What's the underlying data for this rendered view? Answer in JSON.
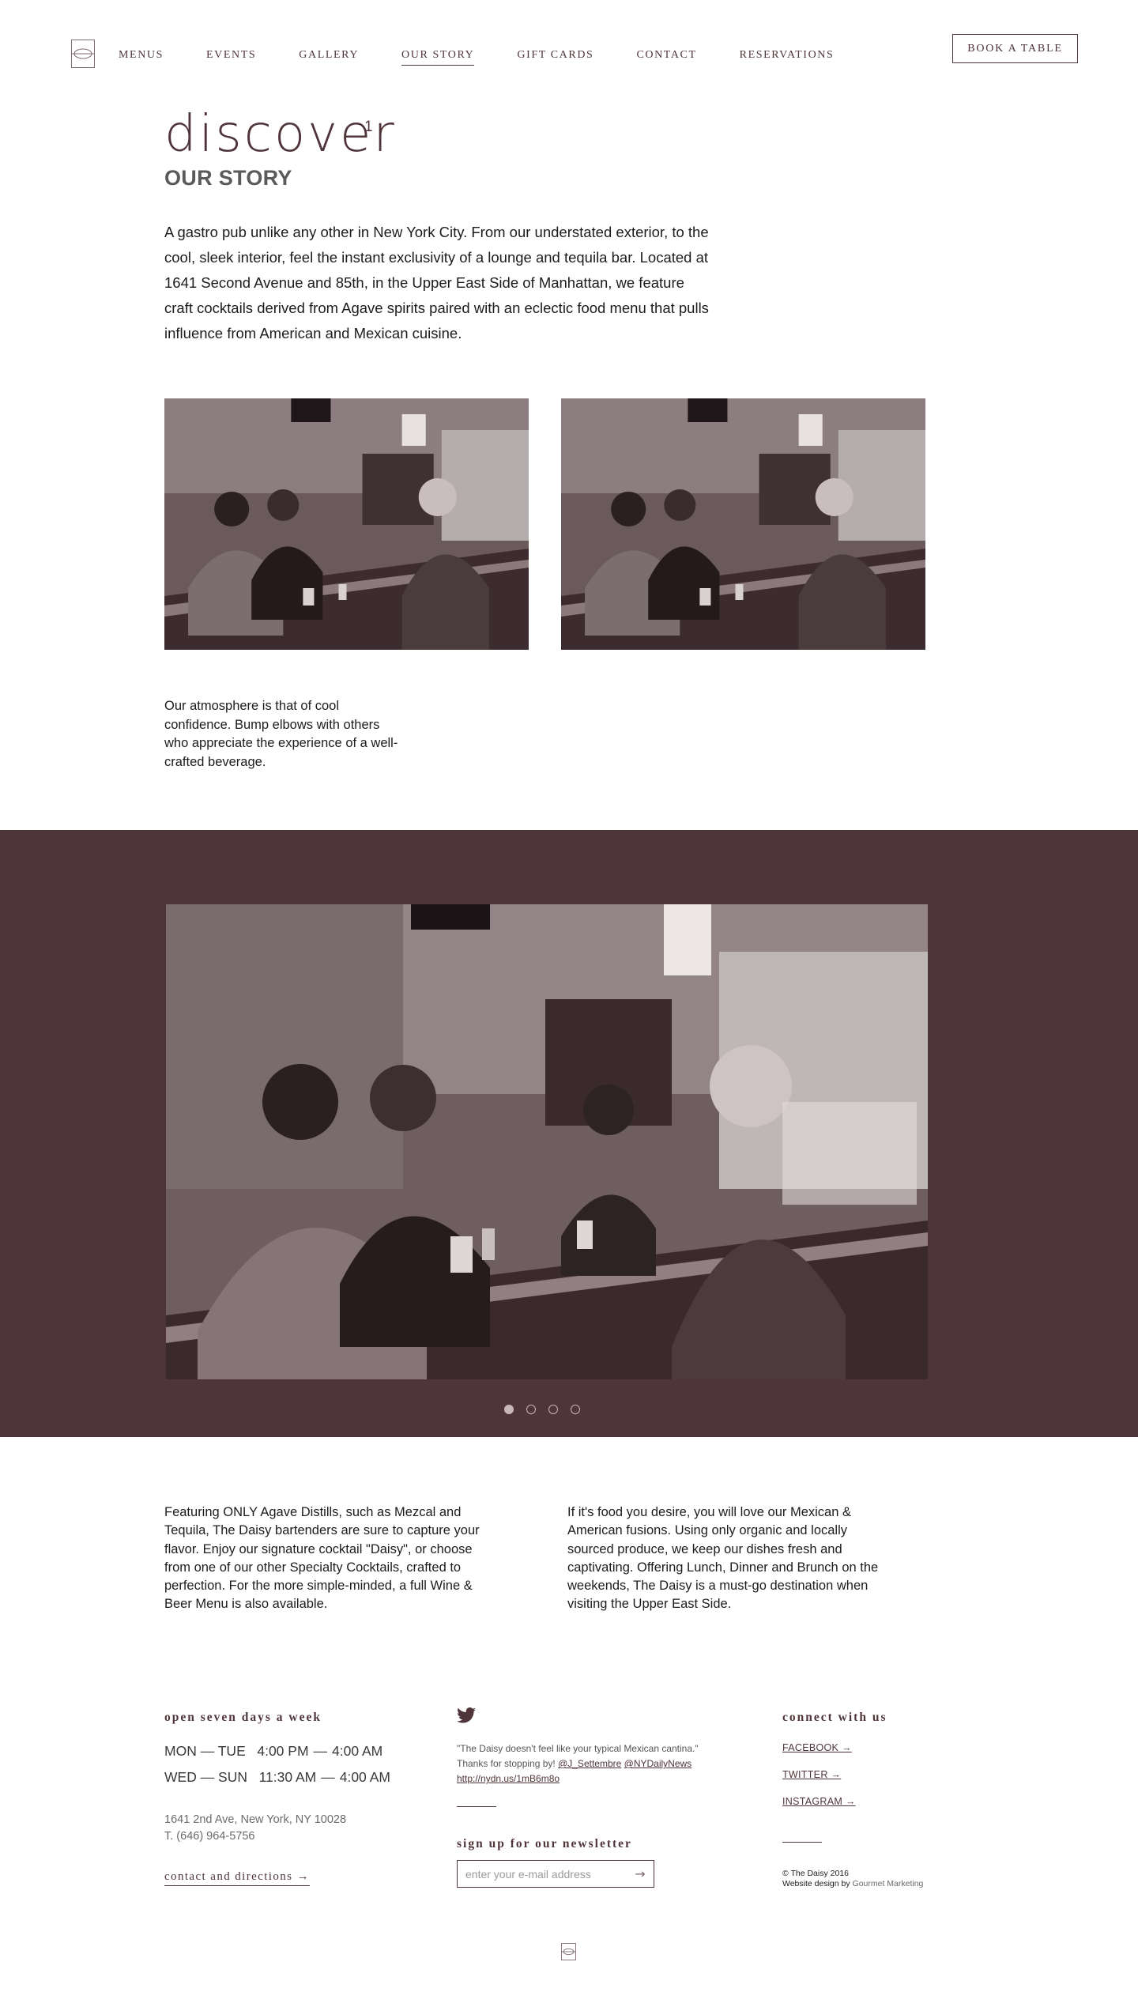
{
  "header": {
    "logo_icon": "daisy-logo-icon",
    "nav": [
      {
        "label": "MENUS"
      },
      {
        "label": "EVENTS"
      },
      {
        "label": "GALLERY"
      },
      {
        "label": "OUR STORY",
        "active": true
      },
      {
        "label": "GIFT CARDS"
      },
      {
        "label": "CONTACT"
      },
      {
        "label": "RESERVATIONS"
      }
    ],
    "book_button": "BOOK A TABLE"
  },
  "intro": {
    "title": "discover",
    "superscript": "1",
    "subtitle": "OUR STORY",
    "body": "A gastro pub unlike any other in New York City. From our understated exterior, to the cool, sleek interior, feel the instant exclusivity of a lounge and tequila bar. Located at 1641 Second Avenue and 85th, in the Upper East Side of Manhattan, we feature craft cocktails derived from Agave spirits paired with an eclectic food menu that pulls influence from American and Mexican cuisine."
  },
  "atmosphere": "Our atmosphere is that of cool confidence. Bump elbows with others who appreciate the experience of a well-crafted beverage.",
  "gallery": {
    "slide_count": 4,
    "active_slide": 1
  },
  "columns": {
    "left": "Featuring ONLY Agave Distills, such as Mezcal and Tequila, The Daisy bartenders are sure to capture your flavor. Enjoy our signature cocktail \"Daisy\", or choose from one of our other Specialty Cocktails, crafted to perfection. For the more simple-minded, a full Wine & Beer Menu is also available.",
    "right": "If it's food you desire, you will love our Mexican & American fusions. Using only organic and locally sourced produce, we keep our dishes fresh and captivating. Offering Lunch, Dinner and Brunch on the weekends, The Daisy is a must-go destination when visiting the Upper East Side."
  },
  "footer": {
    "hours_heading": "open seven days a week",
    "hours": [
      {
        "days": "MON — TUE",
        "open": "4:00 PM",
        "close": "4:00 AM"
      },
      {
        "days": "WED — SUN",
        "open": "11:30 AM",
        "close": "4:00 AM"
      }
    ],
    "address": "1641 2nd Ave, New York, NY 10028",
    "phone": "T. (646) 964-5756",
    "directions_link": "contact and directions →",
    "twitter_icon": "twitter-bird-icon",
    "tweet": {
      "text": "\"The Daisy doesn't feel like your typical Mexican cantina.\"",
      "thanks": "Thanks for stopping by!",
      "mention_1": "@J_Settembre",
      "mention_2": "@NYDailyNews",
      "url": "http://nydn.us/1mB6m8o"
    },
    "newsletter_heading": "sign up for our newsletter",
    "email_placeholder": "enter your e-mail address",
    "submit_arrow": "→",
    "connect_heading": "connect with us",
    "social": [
      {
        "label": "FACEBOOK →"
      },
      {
        "label": "TWITTER →"
      },
      {
        "label": "INSTAGRAM →"
      }
    ],
    "copyright": "© The Daisy 2016",
    "credit_prefix": "Website design by",
    "credit_name": "Gourmet Marketing"
  },
  "colors": {
    "brand": "#4f3539",
    "band_background": "#4e3539",
    "text": "#1c1c1c"
  }
}
